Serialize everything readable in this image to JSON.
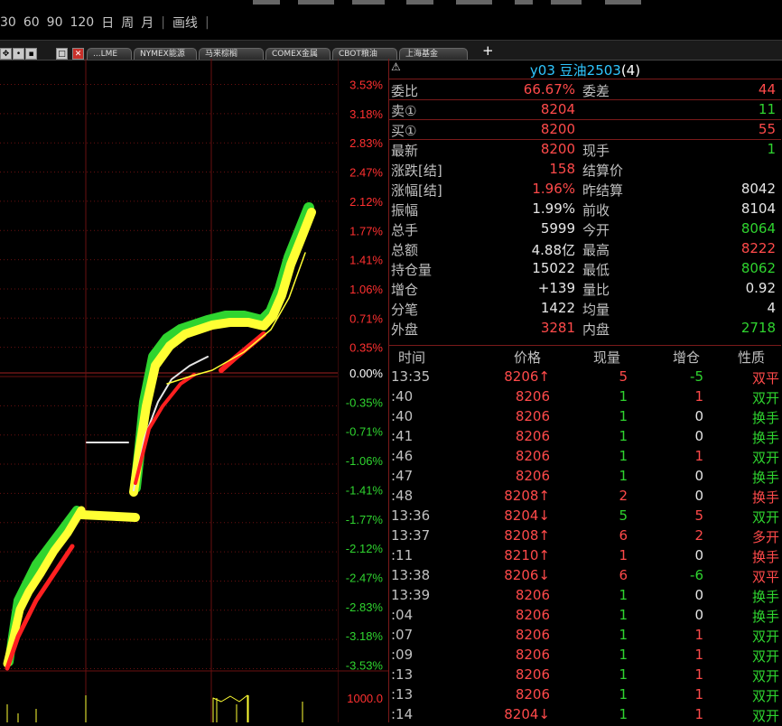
{
  "period_bar": {
    "items": [
      "30",
      "60",
      "90",
      "120",
      "日",
      "周",
      "月",
      "|",
      "画线",
      "|"
    ]
  },
  "tabs": {
    "controls": [
      "✥",
      "•",
      "▪",
      "□",
      "✕"
    ],
    "items": [
      "...LME",
      "NYMEX能源",
      "马来棕榈",
      "COMEX金属",
      "CBOT粮油",
      "上海基金"
    ],
    "add_label": "+"
  },
  "chart": {
    "y_labels_pos": [
      "3.53%",
      "3.18%",
      "2.83%",
      "2.47%",
      "2.12%",
      "1.77%",
      "1.41%",
      "1.06%",
      "0.71%",
      "0.35%"
    ],
    "y_label_zero": "0.00%",
    "y_labels_neg": [
      "-0.35%",
      "-0.71%",
      "-1.06%",
      "-1.41%",
      "-1.77%",
      "-2.12%",
      "-2.47%",
      "-2.83%",
      "-3.18%",
      "-3.53%"
    ],
    "volume_label": "1000.0",
    "colors": {
      "pos": "#ff3030",
      "neg": "#2fd42f",
      "zero": "#ffffff",
      "grid": "#6a1010"
    }
  },
  "panel": {
    "warning_icon": "⚠",
    "title_code": "y03 豆油2503",
    "title_count": "(4)",
    "quotes": [
      {
        "l": "委比",
        "v": "66.67%",
        "vc": "red",
        "l2": "委差",
        "v2": "44",
        "v2c": "red"
      },
      {
        "l": "卖①",
        "v": "8204",
        "vc": "red",
        "l2": "",
        "v2": "11",
        "v2c": "green"
      },
      {
        "l": "买①",
        "v": "8200",
        "vc": "red",
        "l2": "",
        "v2": "55",
        "v2c": "red"
      },
      {
        "l": "最新",
        "v": "8200",
        "vc": "red",
        "l2": "现手",
        "v2": "1",
        "v2c": "green"
      },
      {
        "l": "涨跌[结]",
        "v": "158",
        "vc": "red",
        "l2": "结算价",
        "v2": "",
        "v2c": "white"
      },
      {
        "l": "涨幅[结]",
        "v": "1.96%",
        "vc": "red",
        "l2": "昨结算",
        "v2": "8042",
        "v2c": "white"
      },
      {
        "l": "振幅",
        "v": "1.99%",
        "vc": "white",
        "l2": "前收",
        "v2": "8104",
        "v2c": "white"
      },
      {
        "l": "总手",
        "v": "5999",
        "vc": "white",
        "l2": "今开",
        "v2": "8064",
        "v2c": "green"
      },
      {
        "l": "总额",
        "v": "4.88亿",
        "vc": "white",
        "l2": "最高",
        "v2": "8222",
        "v2c": "red"
      },
      {
        "l": "持仓量",
        "v": "15022",
        "vc": "white",
        "l2": "最低",
        "v2": "8062",
        "v2c": "green"
      },
      {
        "l": "增仓",
        "v": "+139",
        "vc": "white",
        "l2": "量比",
        "v2": "0.92",
        "v2c": "white"
      },
      {
        "l": "分笔",
        "v": "1422",
        "vc": "white",
        "l2": "均量",
        "v2": "4",
        "v2c": "white"
      },
      {
        "l": "外盘",
        "v": "3281",
        "vc": "red",
        "l2": "内盘",
        "v2": "2718",
        "v2c": "green"
      }
    ],
    "tick_headers": [
      "时间",
      "价格",
      "现量",
      "增仓",
      "性质"
    ],
    "ticks": [
      {
        "t": "13:35",
        "p": "8206↑",
        "pc": "red",
        "v": "5",
        "vc": "red",
        "o": "-5",
        "oc": "green",
        "n": "双平",
        "nc": "red"
      },
      {
        "t": ":40",
        "p": "8206",
        "pc": "red",
        "v": "1",
        "vc": "green",
        "o": "1",
        "oc": "red",
        "n": "双开",
        "nc": "green"
      },
      {
        "t": ":40",
        "p": "8206",
        "pc": "red",
        "v": "1",
        "vc": "green",
        "o": "0",
        "oc": "white",
        "n": "换手",
        "nc": "green"
      },
      {
        "t": ":41",
        "p": "8206",
        "pc": "red",
        "v": "1",
        "vc": "green",
        "o": "0",
        "oc": "white",
        "n": "换手",
        "nc": "green"
      },
      {
        "t": ":46",
        "p": "8206",
        "pc": "red",
        "v": "1",
        "vc": "green",
        "o": "1",
        "oc": "red",
        "n": "双开",
        "nc": "green"
      },
      {
        "t": ":47",
        "p": "8206",
        "pc": "red",
        "v": "1",
        "vc": "green",
        "o": "0",
        "oc": "white",
        "n": "换手",
        "nc": "green"
      },
      {
        "t": ":48",
        "p": "8208↑",
        "pc": "red",
        "v": "2",
        "vc": "red",
        "o": "0",
        "oc": "white",
        "n": "换手",
        "nc": "red"
      },
      {
        "t": "13:36",
        "p": "8204↓",
        "pc": "red",
        "v": "5",
        "vc": "green",
        "o": "5",
        "oc": "red",
        "n": "双开",
        "nc": "green"
      },
      {
        "t": "13:37",
        "p": "8208↑",
        "pc": "red",
        "v": "6",
        "vc": "red",
        "o": "2",
        "oc": "red",
        "n": "多开",
        "nc": "red"
      },
      {
        "t": ":11",
        "p": "8210↑",
        "pc": "red",
        "v": "1",
        "vc": "red",
        "o": "0",
        "oc": "white",
        "n": "换手",
        "nc": "red"
      },
      {
        "t": "13:38",
        "p": "8206↓",
        "pc": "red",
        "v": "6",
        "vc": "red",
        "o": "-6",
        "oc": "green",
        "n": "双平",
        "nc": "red"
      },
      {
        "t": "13:39",
        "p": "8206",
        "pc": "red",
        "v": "1",
        "vc": "green",
        "o": "0",
        "oc": "white",
        "n": "换手",
        "nc": "green"
      },
      {
        "t": ":04",
        "p": "8206",
        "pc": "red",
        "v": "1",
        "vc": "green",
        "o": "0",
        "oc": "white",
        "n": "换手",
        "nc": "green"
      },
      {
        "t": ":07",
        "p": "8206",
        "pc": "red",
        "v": "1",
        "vc": "green",
        "o": "1",
        "oc": "red",
        "n": "双开",
        "nc": "green"
      },
      {
        "t": ":09",
        "p": "8206",
        "pc": "red",
        "v": "1",
        "vc": "green",
        "o": "1",
        "oc": "red",
        "n": "双开",
        "nc": "green"
      },
      {
        "t": ":13",
        "p": "8206",
        "pc": "red",
        "v": "1",
        "vc": "green",
        "o": "1",
        "oc": "red",
        "n": "双开",
        "nc": "green"
      },
      {
        "t": ":13",
        "p": "8206",
        "pc": "red",
        "v": "1",
        "vc": "green",
        "o": "1",
        "oc": "red",
        "n": "双开",
        "nc": "green"
      },
      {
        "t": ":14",
        "p": "8204↓",
        "pc": "red",
        "v": "1",
        "vc": "green",
        "o": "1",
        "oc": "red",
        "n": "双开",
        "nc": "green"
      }
    ]
  }
}
